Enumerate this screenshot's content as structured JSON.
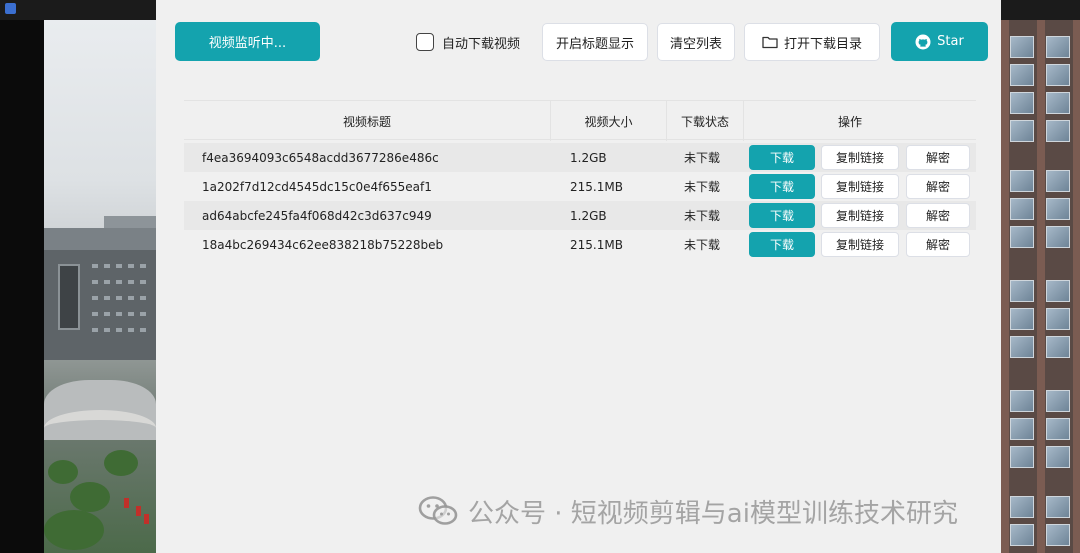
{
  "toolbar": {
    "monitor_label": "视频监听中...",
    "auto_download_label": "自动下载视频",
    "auto_download_checked": false,
    "show_title_label": "开启标题显示",
    "clear_list_label": "清空列表",
    "open_dir_label": "打开下载目录",
    "star_label": "Star"
  },
  "table": {
    "headers": {
      "title": "视频标题",
      "size": "视频大小",
      "status": "下载状态",
      "actions": "操作"
    },
    "action_labels": {
      "download": "下载",
      "copy_link": "复制链接",
      "decrypt": "解密"
    },
    "rows": [
      {
        "title": "f4ea3694093c6548acdd3677286e486c",
        "size": "1.2GB",
        "status": "未下载"
      },
      {
        "title": "1a202f7d12cd4545dc15c0e4f655eaf1",
        "size": "215.1MB",
        "status": "未下载"
      },
      {
        "title": "ad64abcfe245fa4f068d42c3d637c949",
        "size": "1.2GB",
        "status": "未下载"
      },
      {
        "title": "18a4bc269434c62ee838218b75228beb",
        "size": "215.1MB",
        "status": "未下载"
      }
    ]
  },
  "watermark": {
    "text": "公众号 · 短视频剪辑与ai模型训练技术研究"
  },
  "colors": {
    "accent": "#14a3ae",
    "window_bg": "#f0f0f0",
    "row_alt": "#e8e8e8"
  }
}
